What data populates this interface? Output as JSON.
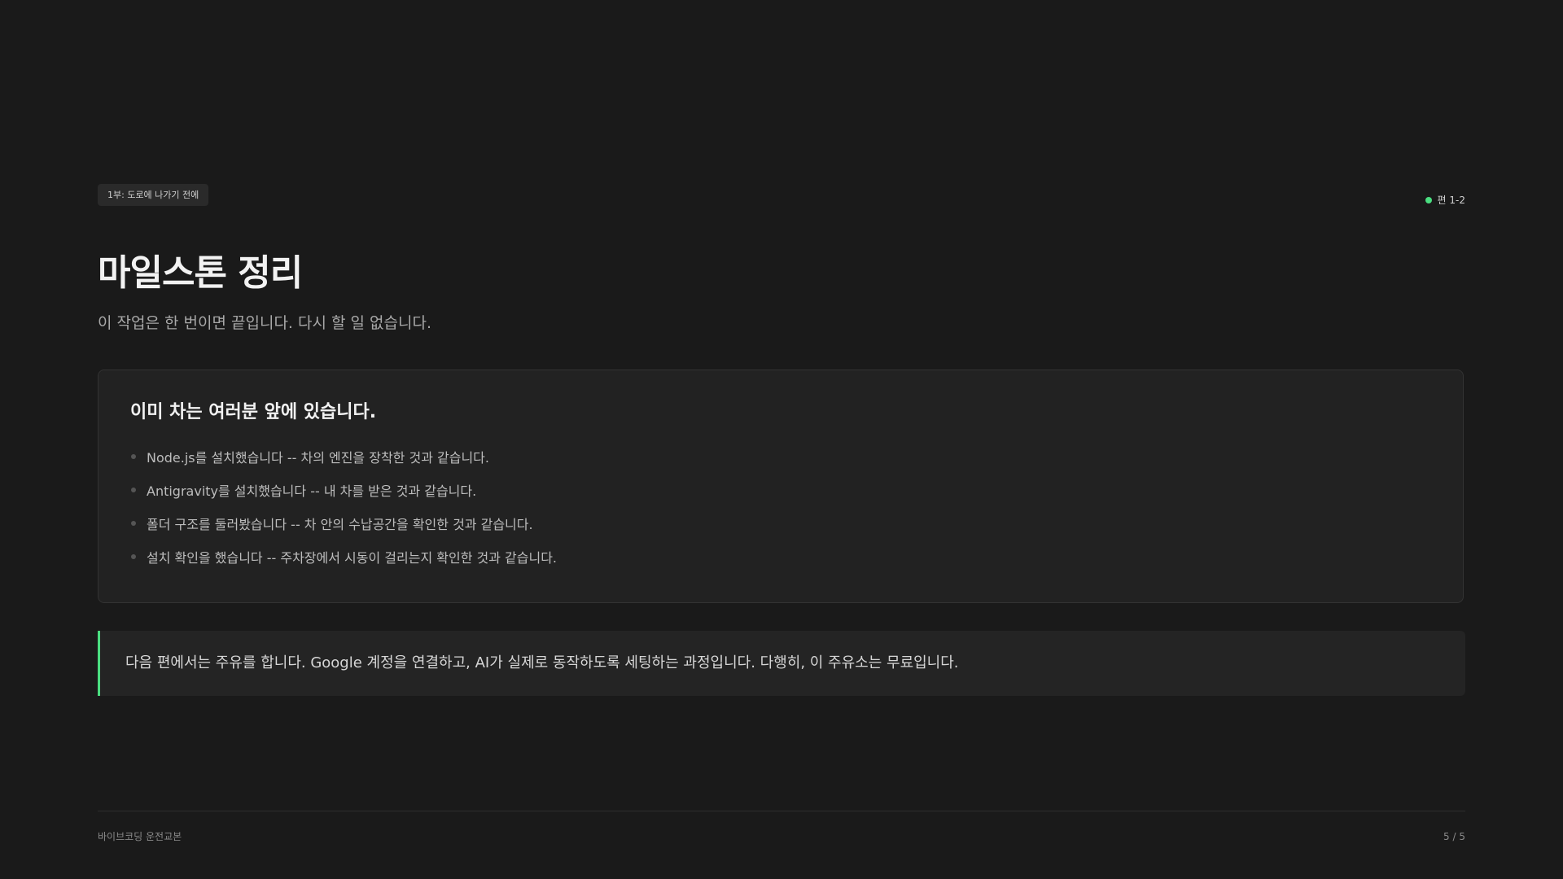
{
  "header": {
    "chapter_tag": "1부: 도로에 나가기 전에",
    "episode": "편 1-2",
    "episode_dot_color": "#4ade80"
  },
  "main": {
    "title": "마일스톤 정리",
    "subtitle": "이 작업은 한 번이면 끝입니다. 다시 할 일 없습니다.",
    "summary": {
      "heading": "이미 차는 여러분 앞에 있습니다.",
      "items": [
        "Node.js를 설치했습니다 -- 차의 엔진을 장착한 것과 같습니다.",
        "Antigravity를 설치했습니다 -- 내 차를 받은 것과 같습니다.",
        "폴더 구조를 둘러봤습니다 -- 차 안의 수납공간을 확인한 것과 같습니다.",
        "설치 확인을 했습니다 -- 주차장에서 시동이 걸리는지 확인한 것과 같습니다."
      ]
    },
    "callout": "다음 편에서는 주유를 합니다. Google 계정을 연결하고, AI가 실제로 동작하도록 세팅하는 과정입니다. 다행히, 이 주유소는 무료입니다.",
    "accent_color": "#4ade80"
  },
  "footer": {
    "course": "바이브코딩 운전교본",
    "page": "5 / 5"
  }
}
